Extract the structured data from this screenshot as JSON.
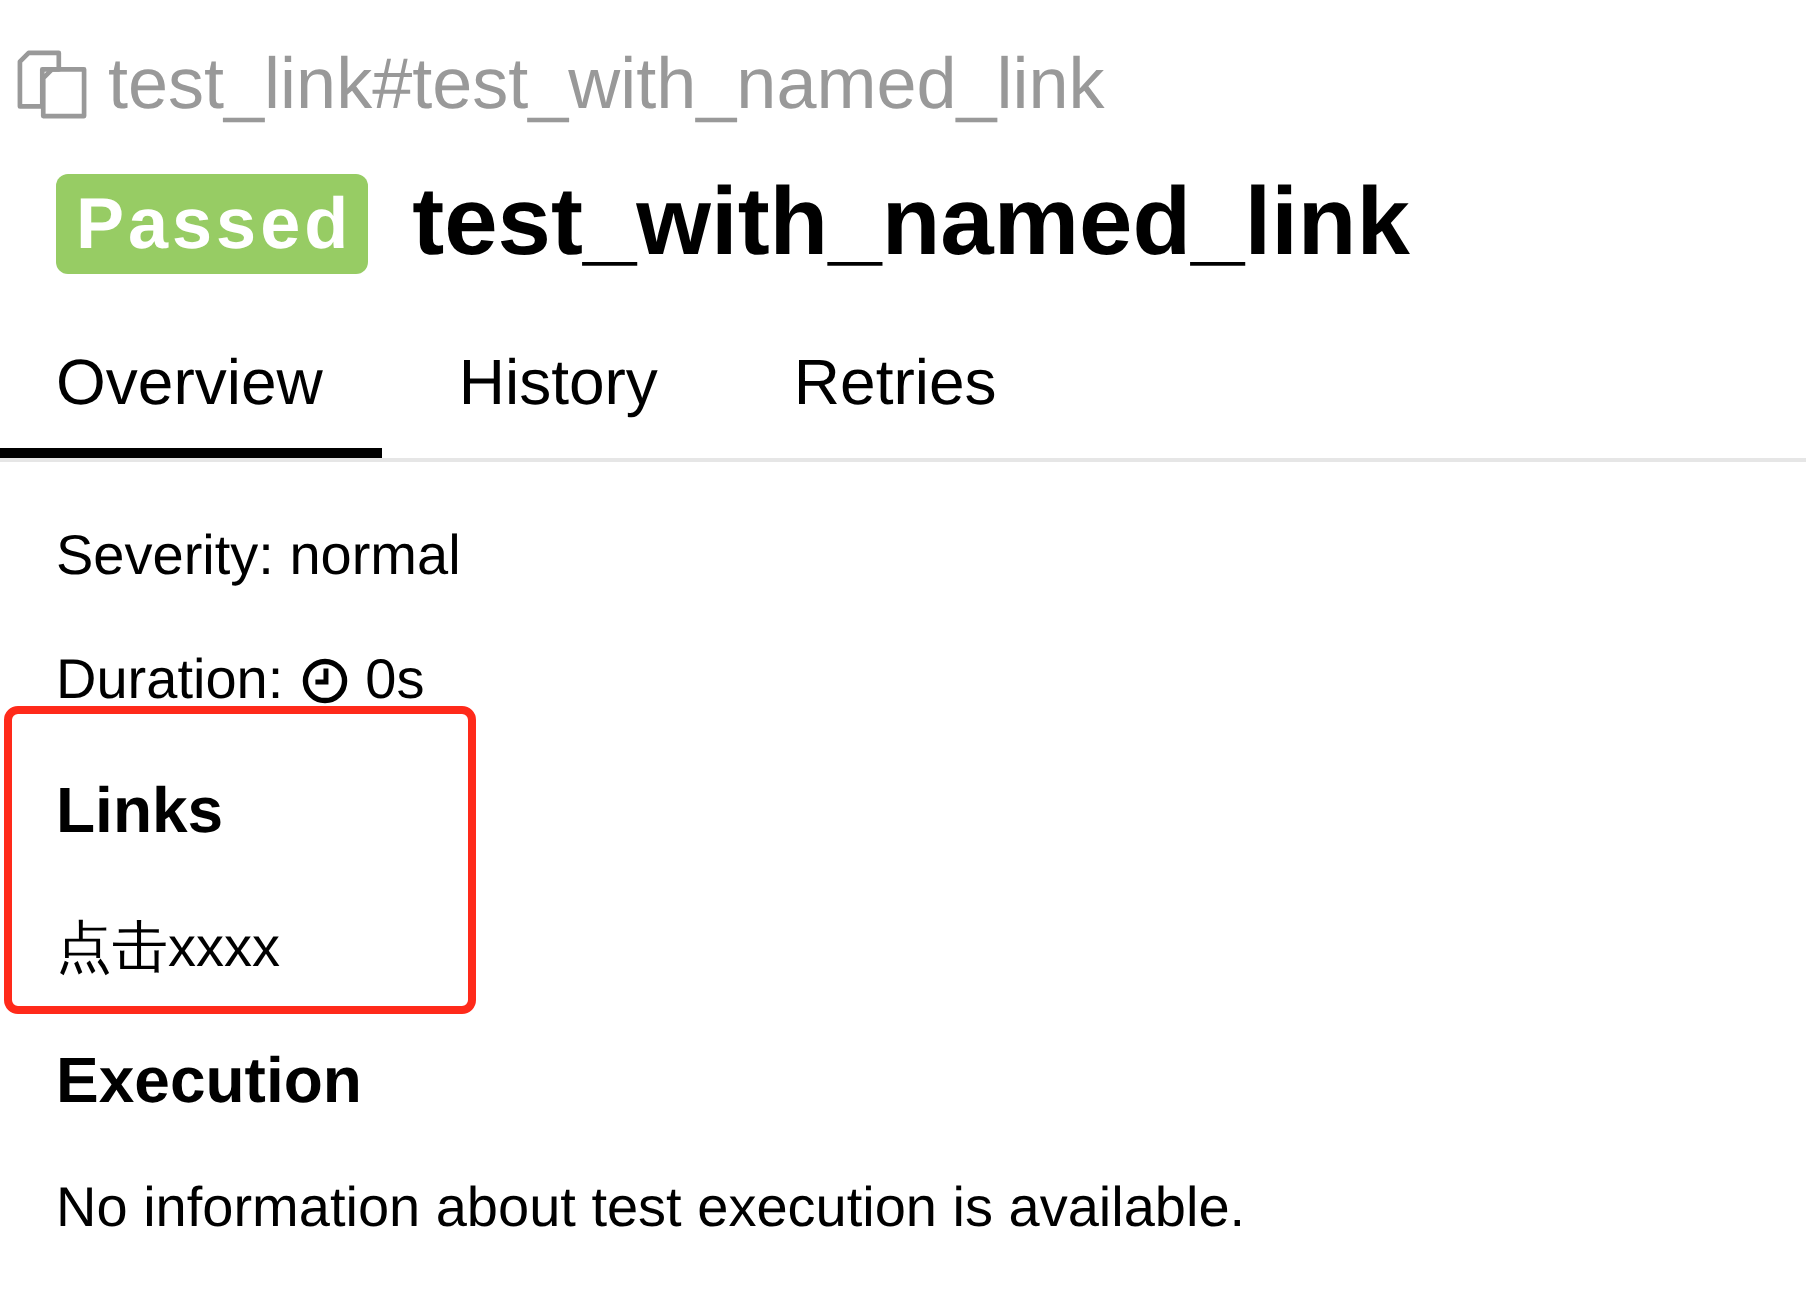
{
  "breadcrumb": {
    "text": "test_link#test_with_named_link"
  },
  "header": {
    "status": {
      "kind": "passed",
      "label": "Passed"
    },
    "title": "test_with_named_link"
  },
  "tabs": [
    {
      "label": "Overview",
      "selected": true
    },
    {
      "label": "History",
      "selected": false
    },
    {
      "label": "Retries",
      "selected": false
    }
  ],
  "severity": {
    "text": "Severity: normal"
  },
  "duration": {
    "label": "Duration:",
    "value": "0s"
  },
  "links": {
    "heading": "Links",
    "highlighted": true,
    "items": [
      {
        "label": "点击xxxx"
      }
    ]
  },
  "execution": {
    "heading": "Execution",
    "message": "No information about test execution is available."
  }
}
